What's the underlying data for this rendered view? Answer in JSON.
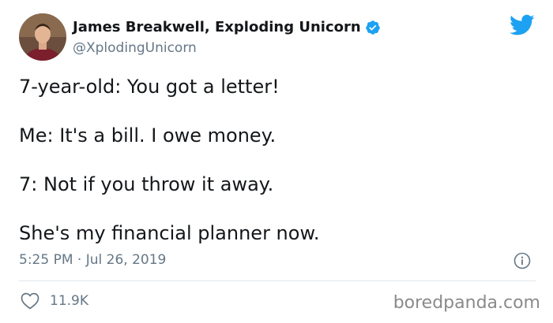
{
  "author": {
    "display_name": "James Breakwell, Exploding Unicorn",
    "handle": "@XplodingUnicorn",
    "verified": true
  },
  "tweet": {
    "lines": [
      "7-year-old: You got a letter!",
      "Me: It's a bill. I owe money.",
      "7: Not if you throw it away.",
      "She's my financial planner now."
    ],
    "timestamp": "5:25 PM · Jul 26, 2019",
    "like_count": "11.9K"
  },
  "watermark": "boredpanda.com",
  "icons": {
    "brand": "twitter-bird-icon",
    "verified": "verified-badge-icon",
    "info": "info-icon",
    "like": "heart-icon"
  },
  "colors": {
    "twitter_blue": "#1da1f2",
    "text": "#14171a",
    "secondary_text": "#657786",
    "divider": "#e1e8ed"
  }
}
